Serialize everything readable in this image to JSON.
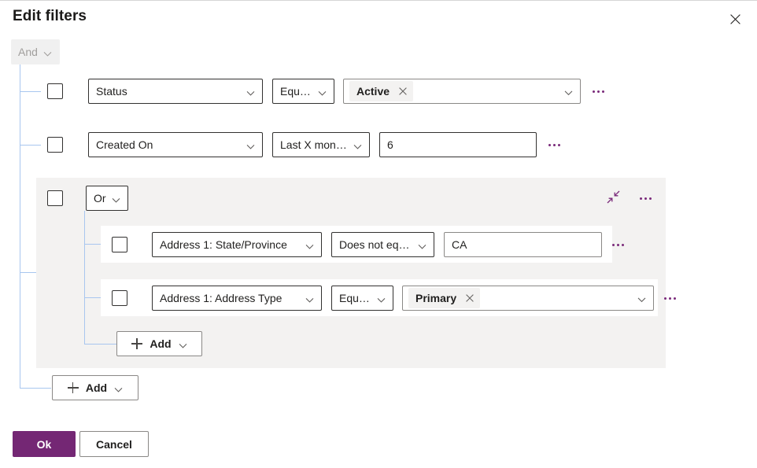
{
  "dialog": {
    "title": "Edit filters",
    "close_icon": "close-icon"
  },
  "root_group": {
    "operator_label": "And",
    "operator_chevron_icon": "chevron-down-icon",
    "add_label": "Add",
    "add_plus_icon": "plus-icon",
    "add_chevron_icon": "chevron-down-icon"
  },
  "rows": [
    {
      "field": "Status",
      "operator": "Equals",
      "value_kind": "tag",
      "value": "Active",
      "remove_tag_icon": "close-icon",
      "overflow_icon": "more-options-icon",
      "field_chevron_icon": "chevron-down-icon",
      "operator_chevron_icon": "chevron-down-icon",
      "value_chevron_icon": "chevron-down-icon"
    },
    {
      "field": "Created On",
      "operator": "Last X months",
      "value_kind": "text",
      "value": "6",
      "overflow_icon": "more-options-icon",
      "field_chevron_icon": "chevron-down-icon",
      "operator_chevron_icon": "chevron-down-icon"
    }
  ],
  "nested_group": {
    "operator_label": "Or",
    "operator_chevron_icon": "chevron-down-icon",
    "collapse_icon": "collapse-diagonal-icon",
    "overflow_icon": "more-options-icon",
    "add_label": "Add",
    "add_plus_icon": "plus-icon",
    "add_chevron_icon": "chevron-down-icon",
    "rows": [
      {
        "field": "Address 1: State/Province",
        "operator": "Does not equal",
        "value_kind": "text",
        "value": "CA",
        "overflow_icon": "more-options-icon",
        "field_chevron_icon": "chevron-down-icon",
        "operator_chevron_icon": "chevron-down-icon"
      },
      {
        "field": "Address 1: Address Type",
        "operator": "Equals",
        "value_kind": "tag",
        "value": "Primary",
        "remove_tag_icon": "close-icon",
        "overflow_icon": "more-options-icon",
        "field_chevron_icon": "chevron-down-icon",
        "operator_chevron_icon": "chevron-down-icon",
        "value_chevron_icon": "chevron-down-icon"
      }
    ]
  },
  "footer": {
    "ok_label": "Ok",
    "cancel_label": "Cancel"
  },
  "colors": {
    "accent": "#742774",
    "tree_line": "#a8c6ef",
    "group_bg": "#f3f2f1",
    "disabled_text": "#a19f9d"
  }
}
